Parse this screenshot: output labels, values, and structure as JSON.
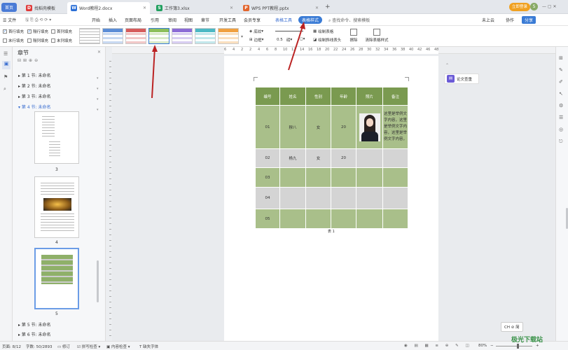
{
  "tabs": [
    {
      "label": "首页"
    },
    {
      "label": "找稻壳模板"
    },
    {
      "label": "Word教程2.docx"
    },
    {
      "label": "工作簿3.xlsx"
    },
    {
      "label": "WPS PPT教程.pptx"
    }
  ],
  "tab_new": "+",
  "top_right": {
    "login": "立即登录",
    "avatar": "S"
  },
  "menu": {
    "file": "文件",
    "items": [
      "开始",
      "插入",
      "页面布局",
      "引用",
      "审阅",
      "视图",
      "章节",
      "开发工具",
      "会员专享"
    ],
    "table_tools": "表格工具",
    "table_style": "表格样式",
    "search": "查找命令、搜索模板",
    "cloud": "未上云",
    "collab": "协作",
    "share": "分享"
  },
  "ribbon": {
    "checks": [
      {
        "label": "首行填充",
        "checked": true
      },
      {
        "label": "隔行填充",
        "checked": true
      },
      {
        "label": "首列填充",
        "checked": false
      },
      {
        "label": "末行填充",
        "checked": false
      },
      {
        "label": "隔列填充",
        "checked": false
      },
      {
        "label": "末列填充",
        "checked": false
      }
    ],
    "shading": "底纹",
    "border": "边框",
    "border_width": "0.5",
    "border_unit": "磅",
    "draw_table": "绘制表格",
    "draw_diag": "绘制斜线表头",
    "erase": "擦除",
    "clear_style": "清除表格样式",
    "swatch_colors": [
      "#5b8dd6",
      "#d65b5b",
      "#8cbf5a",
      "#8b6bd6",
      "#4bb8c4",
      "#f0a040"
    ]
  },
  "nav": {
    "title": "章节",
    "sections": [
      "第 1 节: 未命名",
      "第 2 节: 未命名",
      "第 3 节: 未命名",
      "第 4 节: 未命名",
      "第 5 节: 未命名",
      "第 6 节: 未命名"
    ],
    "page_numbers": [
      "3",
      "4",
      "5"
    ]
  },
  "ruler_marks": [
    "6",
    "4",
    "2",
    "2",
    "4",
    "6",
    "8",
    "10",
    "12",
    "14",
    "16",
    "18",
    "20",
    "22",
    "24",
    "26",
    "28",
    "30",
    "32",
    "34",
    "36",
    "38",
    "40",
    "42",
    "46",
    "48"
  ],
  "table": {
    "headers": [
      "编号",
      "姓名",
      "性别",
      "年龄",
      "照片",
      "备注"
    ],
    "rows": [
      [
        "01",
        "穆八",
        "女",
        "20",
        "",
        "这里是举例文字内容，这里是举例文字内容，这里是举例文字内容，"
      ],
      [
        "02",
        "杨九",
        "女",
        "20",
        "",
        ""
      ],
      [
        "03",
        "",
        "",
        "",
        "",
        ""
      ],
      [
        "04",
        "",
        "",
        "",
        "",
        ""
      ],
      [
        "05",
        "",
        "",
        "",
        "",
        ""
      ]
    ],
    "caption": "表 1",
    "colors": {
      "header": "#7a9a50",
      "row_odd": "#a9bf8a",
      "row_even": "#d4d4d4"
    }
  },
  "float_panel": {
    "label": "论文查重"
  },
  "ime": "CH ⊘ 简",
  "status": {
    "page": "页面: 8/12",
    "words": "字数: 50/2893",
    "revise": "修订",
    "spell": "拼写检查",
    "content_check": "内容检查",
    "missing_font": "缺失字体",
    "zoom": "80%"
  },
  "watermark": "极光下载站"
}
